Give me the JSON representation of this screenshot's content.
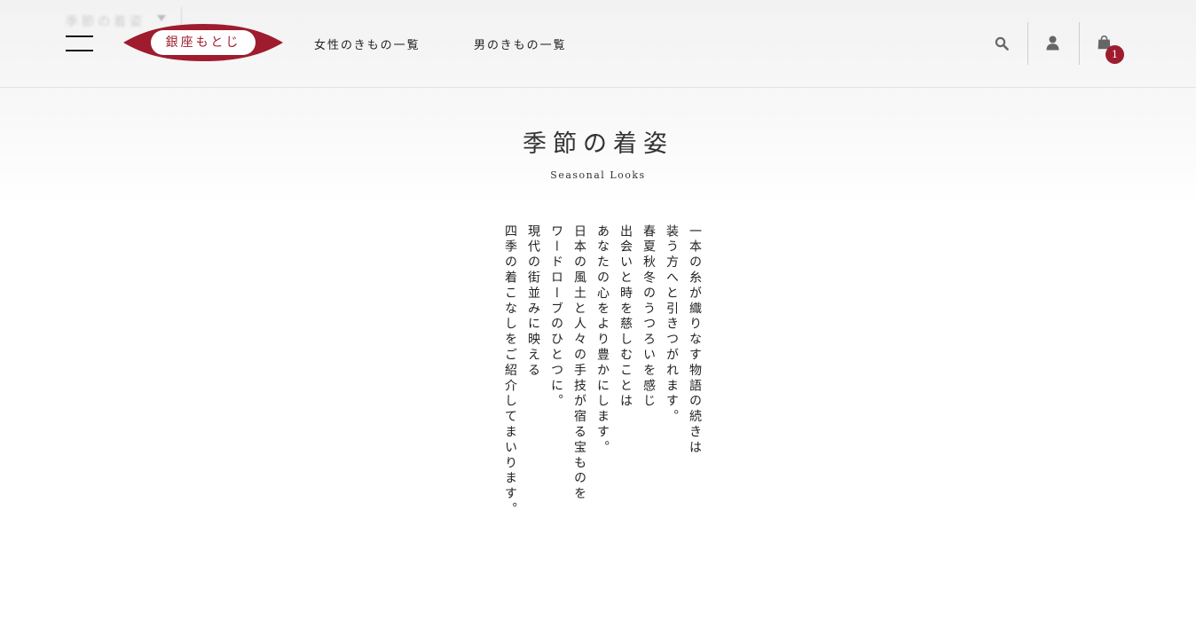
{
  "header": {
    "ghost_text": "季節の着姿",
    "logo_text": "銀座もとじ",
    "nav": [
      "女性のきもの一覧",
      "男のきもの一覧"
    ],
    "cart_count": "1",
    "icons": [
      "hamburger-menu-icon",
      "search-icon",
      "user-icon",
      "shopping-bag-icon"
    ]
  },
  "main": {
    "title": "季節の着姿",
    "subtitle": "Seasonal Looks",
    "poem": [
      "一本の糸が織りなす物語の続きは",
      "装う方へと引きつがれます。",
      "春夏秋冬のうつろいを感じ",
      "出会いと時を慈しむことは",
      "あなたの心をより豊かにします。",
      "日本の風土と人々の手技が宿る宝ものを",
      "ワードローブのひとつに。",
      "現代の街並みに映える",
      "四季の着こなしをご紹介してまいります。"
    ]
  },
  "colors": {
    "brand": "#9e1c2e",
    "text": "#222222",
    "icon": "#666666"
  }
}
